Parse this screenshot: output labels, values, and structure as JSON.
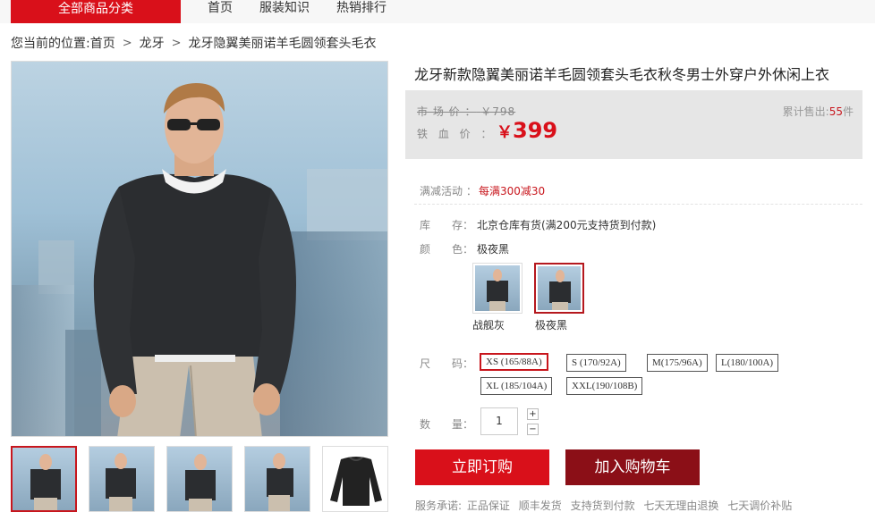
{
  "nav": {
    "all_categories": "全部商品分类",
    "links": [
      "首页",
      "服装知识",
      "热销排行"
    ]
  },
  "breadcrumb": {
    "prefix": "您当前的位置:",
    "items": [
      "首页",
      "龙牙",
      "龙牙隐翼美丽诺羊毛圆领套头毛衣"
    ]
  },
  "product": {
    "title": "龙牙新款隐翼美丽诺羊毛圆领套头毛衣秋冬男士外穿户外休闲上衣",
    "market_price_label": "市 场 价 ：",
    "market_price": "￥798",
    "sold_label": "累计售出:",
    "sold_count": "55",
    "sold_unit": "件",
    "price_label": "铁 血 价 ：",
    "price_currency": "￥",
    "price": "399",
    "promo_label": "满减活动 ：",
    "promo_value": "每满300减30",
    "stock_label": "库　　存：",
    "stock_value": "北京仓库有货(满200元支持货到付款)",
    "color_label": "颜　　色：",
    "color_value": "极夜黑",
    "colors": [
      "战舰灰",
      "极夜黑"
    ],
    "size_label": "尺　　码：",
    "sizes": [
      "XS (165/88A)",
      "S (170/92A)",
      "M(175/96A)",
      "L(180/100A)",
      "XL (185/104A)",
      "XXL(190/108B)"
    ],
    "qty_label": "数　　量：",
    "qty": "1",
    "plus": "+",
    "minus": "−",
    "buy_label": "立即订购",
    "cart_label": "加入购物车",
    "service_label": "服务承诺:",
    "services": [
      "正品保证",
      "顺丰发货",
      "支持货到付款",
      "七天无理由退换",
      "七天调价补贴"
    ]
  },
  "colors": {
    "brand_red": "#d9101a",
    "dark_red": "#8b0f17",
    "price_box_bg": "#e6e6e6"
  }
}
